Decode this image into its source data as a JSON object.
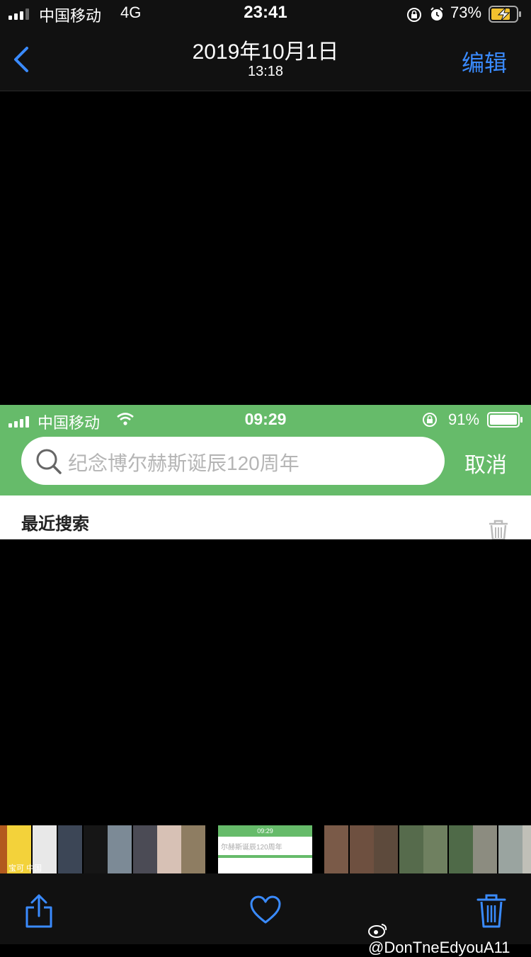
{
  "status_bar": {
    "carrier": "中国移动",
    "network": "4G",
    "time": "23:41",
    "battery": "73%"
  },
  "nav": {
    "title": "2019年10月1日",
    "subtitle": "13:18",
    "edit_label": "编辑",
    "back_icon": "chevron-left-icon",
    "accent": "#3a8bff"
  },
  "embedded_screenshot": {
    "status": {
      "carrier": "中国移动",
      "time": "09:29",
      "battery": "91%"
    },
    "search_placeholder": "纪念博尔赫斯诞辰120周年",
    "cancel_label": "取消",
    "recent_heading": "最近搜索",
    "bar_color": "#66bb6a"
  },
  "thumbnail_strip": {
    "text_fragment": "宝可 中国",
    "active_thumb": {
      "time": "09:29",
      "text": "尔赫斯诞辰120周年"
    }
  },
  "toolbar": {
    "share_icon": "share-icon",
    "favorite_icon": "heart-icon",
    "delete_icon": "trash-icon"
  },
  "watermark": "@DonTneEdyouA11"
}
